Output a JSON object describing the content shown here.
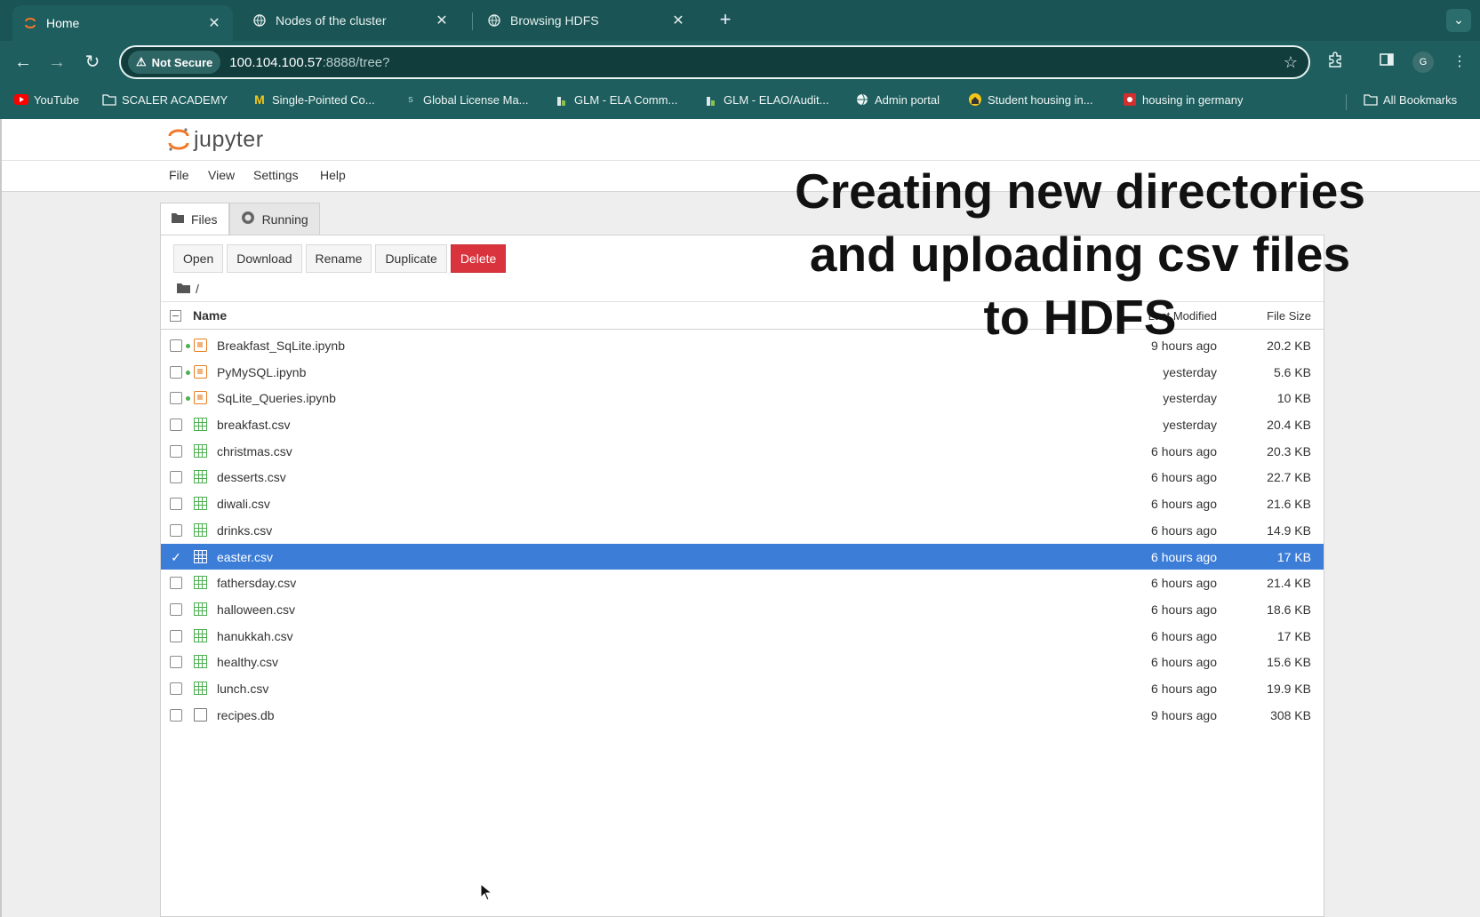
{
  "browser": {
    "tabs": [
      {
        "title": "Home",
        "icon": "jupyter-icon",
        "active": true
      },
      {
        "title": "Nodes of the cluster",
        "icon": "globe-icon",
        "active": false
      },
      {
        "title": "Browsing HDFS",
        "icon": "globe-icon",
        "active": false
      }
    ],
    "address": {
      "security_label": "Not Secure",
      "url_host": "100.104.100.57",
      "url_rest": ":8888/tree?"
    },
    "bookmarks": [
      {
        "label": "YouTube",
        "icon": "youtube-icon"
      },
      {
        "label": "SCALER ACADEMY",
        "icon": "folder-icon"
      },
      {
        "label": "Single-Pointed Co...",
        "icon": "m-icon"
      },
      {
        "label": "Global License Ma...",
        "icon": "s-icon"
      },
      {
        "label": "GLM - ELA Comm...",
        "icon": "glm-icon"
      },
      {
        "label": "GLM - ELAO/Audit...",
        "icon": "glm-icon"
      },
      {
        "label": "Admin portal",
        "icon": "globe-icon"
      },
      {
        "label": "Student housing in...",
        "icon": "housing-icon"
      },
      {
        "label": "housing in germany",
        "icon": "red-icon"
      }
    ],
    "all_bookmarks_label": "All Bookmarks",
    "profile_initial": "G"
  },
  "jupyter": {
    "logo_text": "jupyter",
    "menu": [
      "File",
      "View",
      "Settings",
      "Help"
    ],
    "panel_tabs": [
      {
        "label": "Files",
        "icon": "folder-icon"
      },
      {
        "label": "Running",
        "icon": "running-icon"
      }
    ],
    "actions": {
      "open": "Open",
      "download": "Download",
      "rename": "Rename",
      "duplicate": "Duplicate",
      "delete": "Delete"
    },
    "breadcrumb": "/",
    "columns": {
      "name": "Name",
      "modified": "Last Modified",
      "size": "File Size"
    },
    "files": [
      {
        "name": "Breakfast_SqLite.ipynb",
        "type": "notebook",
        "running": true,
        "modified": "9 hours ago",
        "size": "20.2 KB",
        "selected": false
      },
      {
        "name": "PyMySQL.ipynb",
        "type": "notebook",
        "running": true,
        "modified": "yesterday",
        "size": "5.6 KB",
        "selected": false
      },
      {
        "name": "SqLite_Queries.ipynb",
        "type": "notebook",
        "running": true,
        "modified": "yesterday",
        "size": "10 KB",
        "selected": false
      },
      {
        "name": "breakfast.csv",
        "type": "csv",
        "running": false,
        "modified": "yesterday",
        "size": "20.4 KB",
        "selected": false
      },
      {
        "name": "christmas.csv",
        "type": "csv",
        "running": false,
        "modified": "6 hours ago",
        "size": "20.3 KB",
        "selected": false
      },
      {
        "name": "desserts.csv",
        "type": "csv",
        "running": false,
        "modified": "6 hours ago",
        "size": "22.7 KB",
        "selected": false
      },
      {
        "name": "diwali.csv",
        "type": "csv",
        "running": false,
        "modified": "6 hours ago",
        "size": "21.6 KB",
        "selected": false
      },
      {
        "name": "drinks.csv",
        "type": "csv",
        "running": false,
        "modified": "6 hours ago",
        "size": "14.9 KB",
        "selected": false
      },
      {
        "name": "easter.csv",
        "type": "csv",
        "running": false,
        "modified": "6 hours ago",
        "size": "17 KB",
        "selected": true
      },
      {
        "name": "fathersday.csv",
        "type": "csv",
        "running": false,
        "modified": "6 hours ago",
        "size": "21.4 KB",
        "selected": false
      },
      {
        "name": "halloween.csv",
        "type": "csv",
        "running": false,
        "modified": "6 hours ago",
        "size": "18.6 KB",
        "selected": false
      },
      {
        "name": "hanukkah.csv",
        "type": "csv",
        "running": false,
        "modified": "6 hours ago",
        "size": "17 KB",
        "selected": false
      },
      {
        "name": "healthy.csv",
        "type": "csv",
        "running": false,
        "modified": "6 hours ago",
        "size": "15.6 KB",
        "selected": false
      },
      {
        "name": "lunch.csv",
        "type": "csv",
        "running": false,
        "modified": "6 hours ago",
        "size": "19.9 KB",
        "selected": false
      },
      {
        "name": "recipes.db",
        "type": "file",
        "running": false,
        "modified": "9 hours ago",
        "size": "308 KB",
        "selected": false
      }
    ]
  },
  "overlay": {
    "lines": [
      "Creating new directories",
      "and uploading csv files",
      "to HDFS"
    ]
  },
  "colors": {
    "chrome": "#1f5e5e",
    "selected_row": "#3c7dd8",
    "delete_button": "#d9343d",
    "notebook_icon": "#e67e22",
    "csv_icon": "#4caf50"
  }
}
